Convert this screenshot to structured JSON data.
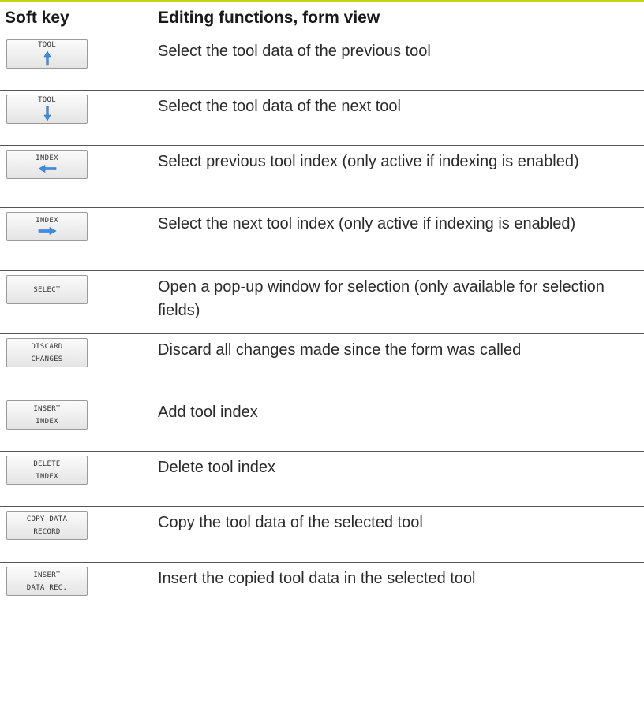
{
  "header": {
    "col1": "Soft key",
    "col2": "Editing functions, form view"
  },
  "colors": {
    "accent_rule": "#c3d410",
    "arrow_blue": "#3a8ee6"
  },
  "rows": [
    {
      "key_lines": [
        "TOOL"
      ],
      "icon": "arrow-up-icon",
      "desc": "Select the tool data of the previous tool"
    },
    {
      "key_lines": [
        "TOOL"
      ],
      "icon": "arrow-down-icon",
      "desc": "Select the tool data of the next tool"
    },
    {
      "key_lines": [
        "INDEX"
      ],
      "icon": "arrow-left-icon",
      "desc": "Select previous tool index (only active if indexing is enabled)"
    },
    {
      "key_lines": [
        "INDEX"
      ],
      "icon": "arrow-right-icon",
      "desc": "Select the next tool index (only active if indexing is enabled)"
    },
    {
      "key_lines": [
        "SELECT"
      ],
      "icon": "",
      "desc": "Open a pop-up window for selection (only available for selection fields)"
    },
    {
      "key_lines": [
        "DISCARD",
        "CHANGES"
      ],
      "icon": "",
      "desc": "Discard all changes made since the form was called"
    },
    {
      "key_lines": [
        "INSERT",
        "INDEX"
      ],
      "icon": "",
      "desc": "Add tool index"
    },
    {
      "key_lines": [
        "DELETE",
        "INDEX"
      ],
      "icon": "",
      "desc": "Delete tool index"
    },
    {
      "key_lines": [
        "COPY DATA",
        "RECORD"
      ],
      "icon": "",
      "desc": "Copy the tool data of the selected tool"
    },
    {
      "key_lines": [
        "INSERT",
        "DATA REC."
      ],
      "icon": "",
      "desc": "Insert the copied tool data in the selected tool"
    }
  ]
}
